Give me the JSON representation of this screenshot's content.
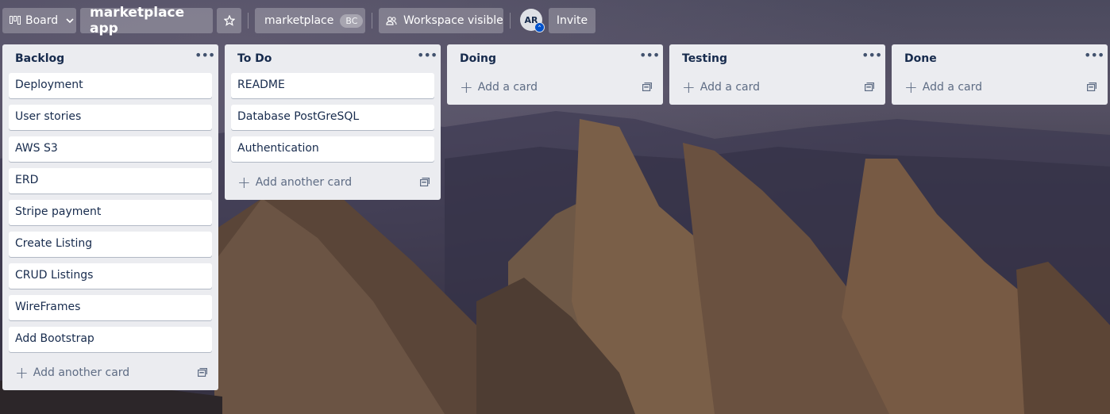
{
  "board_switcher": {
    "label": "Board"
  },
  "board": {
    "title": "marketplace app"
  },
  "workspace": {
    "name": "marketplace",
    "badge": "BC"
  },
  "visibility": {
    "label": "Workspace visible"
  },
  "member": {
    "initials": "AR"
  },
  "invite": {
    "label": "Invite"
  },
  "lists": [
    {
      "title": "Backlog",
      "cards": [
        "Deployment",
        "User stories",
        "AWS S3",
        "ERD",
        "Stripe payment",
        "Create Listing",
        "CRUD Listings",
        "WireFrames",
        "Add Bootstrap"
      ],
      "add_label": "Add another card"
    },
    {
      "title": "To Do",
      "cards": [
        "README",
        "Database PostGreSQL",
        "Authentication"
      ],
      "add_label": "Add another card"
    },
    {
      "title": "Doing",
      "cards": [],
      "add_label": "Add a card"
    },
    {
      "title": "Testing",
      "cards": [],
      "add_label": "Add a card"
    },
    {
      "title": "Done",
      "cards": [],
      "add_label": "Add a card"
    }
  ],
  "colors": {
    "list_bg": "#ebecf0",
    "card_bg": "#ffffff",
    "text": "#172b4d",
    "muted": "#5e6c84"
  }
}
